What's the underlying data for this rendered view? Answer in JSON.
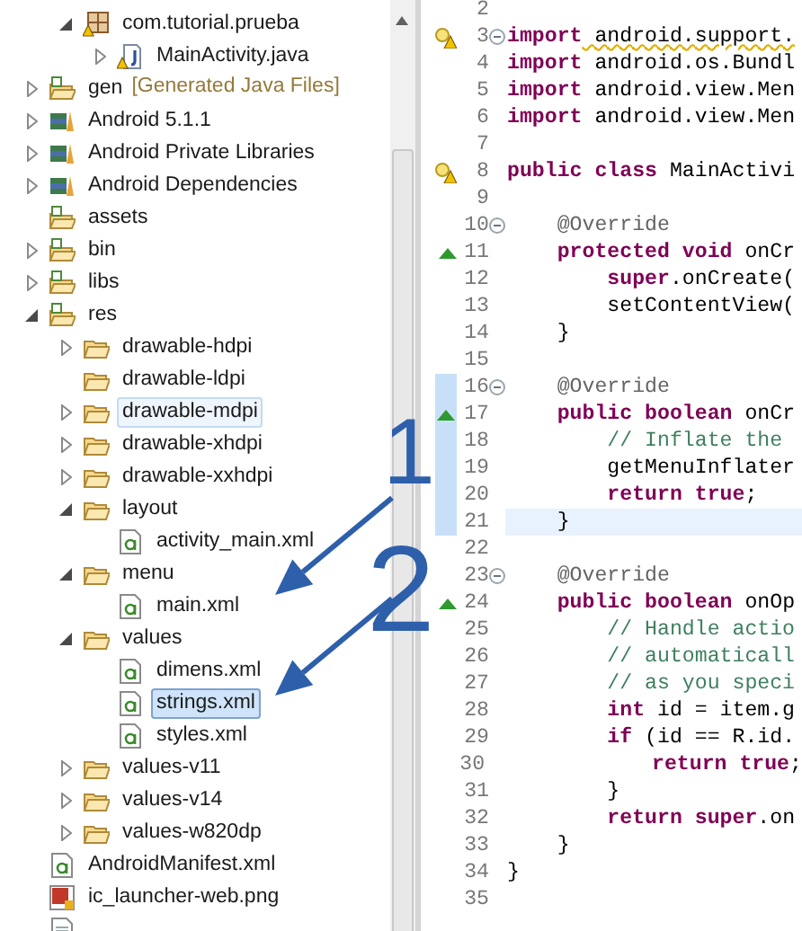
{
  "tree": {
    "scrolled_children": [
      {
        "label": "com.tutorial.prueba",
        "kind": "package",
        "expanded": true,
        "selected": false,
        "hovered": false,
        "children": [
          {
            "label": "MainActivity.java",
            "kind": "java",
            "expanded": false,
            "selected": false,
            "hovered": false
          }
        ]
      }
    ],
    "items": [
      {
        "label": "gen",
        "note": "[Generated Java Files]",
        "kind": "source-folder",
        "expanded": false,
        "selected": false,
        "hovered": false
      },
      {
        "label": "Android 5.1.1",
        "kind": "library",
        "expanded": false,
        "selected": false,
        "hovered": false
      },
      {
        "label": "Android Private Libraries",
        "kind": "library",
        "expanded": false,
        "selected": false,
        "hovered": false
      },
      {
        "label": "Android Dependencies",
        "kind": "library",
        "expanded": false,
        "selected": false,
        "hovered": false
      },
      {
        "label": "assets",
        "kind": "source-folder",
        "selected": false,
        "hovered": false
      },
      {
        "label": "bin",
        "kind": "source-folder",
        "expanded": false,
        "selected": false,
        "hovered": false
      },
      {
        "label": "libs",
        "kind": "source-folder",
        "expanded": false,
        "selected": false,
        "hovered": false
      },
      {
        "label": "res",
        "kind": "source-folder",
        "expanded": true,
        "selected": false,
        "hovered": false,
        "children": [
          {
            "label": "drawable-hdpi",
            "kind": "folder",
            "expanded": false,
            "selected": false,
            "hovered": false
          },
          {
            "label": "drawable-ldpi",
            "kind": "folder",
            "selected": false,
            "hovered": false
          },
          {
            "label": "drawable-mdpi",
            "kind": "folder",
            "expanded": false,
            "selected": false,
            "hovered": true
          },
          {
            "label": "drawable-xhdpi",
            "kind": "folder",
            "expanded": false,
            "selected": false,
            "hovered": false
          },
          {
            "label": "drawable-xxhdpi",
            "kind": "folder",
            "expanded": false,
            "selected": false,
            "hovered": false
          },
          {
            "label": "layout",
            "kind": "folder",
            "expanded": true,
            "selected": false,
            "hovered": false,
            "children": [
              {
                "label": "activity_main.xml",
                "kind": "xml",
                "selected": false,
                "hovered": false
              }
            ]
          },
          {
            "label": "menu",
            "kind": "folder",
            "expanded": true,
            "selected": false,
            "hovered": false,
            "children": [
              {
                "label": "main.xml",
                "kind": "xml",
                "selected": false,
                "hovered": false
              }
            ]
          },
          {
            "label": "values",
            "kind": "folder",
            "expanded": true,
            "selected": false,
            "hovered": false,
            "children": [
              {
                "label": "dimens.xml",
                "kind": "xml",
                "selected": false,
                "hovered": false
              },
              {
                "label": "strings.xml",
                "kind": "xml",
                "selected": true,
                "hovered": false
              },
              {
                "label": "styles.xml",
                "kind": "xml",
                "selected": false,
                "hovered": false
              }
            ]
          },
          {
            "label": "values-v11",
            "kind": "folder",
            "expanded": false,
            "selected": false,
            "hovered": false
          },
          {
            "label": "values-v14",
            "kind": "folder",
            "expanded": false,
            "selected": false,
            "hovered": false
          },
          {
            "label": "values-w820dp",
            "kind": "folder",
            "expanded": false,
            "selected": false,
            "hovered": false
          }
        ]
      },
      {
        "label": "AndroidManifest.xml",
        "kind": "xml",
        "selected": false,
        "hovered": false
      },
      {
        "label": "ic_launcher-web.png",
        "kind": "image",
        "selected": false,
        "hovered": false
      },
      {
        "kind": "text"
      }
    ]
  },
  "editor": {
    "lines": [
      {
        "number": "2"
      },
      {
        "number": "3",
        "warning_marker": true,
        "fold": true,
        "tokens": [
          {
            "kind": "keyword",
            "text": "import"
          },
          {
            "kind": "warning",
            "text": " android.support."
          }
        ]
      },
      {
        "number": "4",
        "tokens": [
          {
            "kind": "keyword",
            "text": "import"
          },
          {
            "kind": "plain",
            "text": " android.os.Bundl"
          }
        ]
      },
      {
        "number": "5",
        "tokens": [
          {
            "kind": "keyword",
            "text": "import"
          },
          {
            "kind": "plain",
            "text": " android.view.Men"
          }
        ]
      },
      {
        "number": "6",
        "tokens": [
          {
            "kind": "keyword",
            "text": "import"
          },
          {
            "kind": "plain",
            "text": " android.view.Men"
          }
        ]
      },
      {
        "number": "7"
      },
      {
        "number": "8",
        "warning_marker": true,
        "tokens": [
          {
            "kind": "keyword",
            "text": "public class"
          },
          {
            "kind": "plain",
            "text": " MainActivi"
          }
        ]
      },
      {
        "number": "9"
      },
      {
        "number": "10",
        "fold": true,
        "tokens": [
          {
            "kind": "annotation",
            "text": "    @Override"
          }
        ]
      },
      {
        "number": "11",
        "override_marker": true,
        "tokens": [
          {
            "kind": "keyword",
            "text": "    protected void"
          },
          {
            "kind": "plain",
            "text": " onCr"
          }
        ]
      },
      {
        "number": "12",
        "tokens": [
          {
            "kind": "keyword",
            "text": "        super"
          },
          {
            "kind": "plain",
            "text": ".onCreate("
          }
        ]
      },
      {
        "number": "13",
        "tokens": [
          {
            "kind": "plain",
            "text": "        setContentView("
          }
        ]
      },
      {
        "number": "14",
        "tokens": [
          {
            "kind": "plain",
            "text": "    }"
          }
        ]
      },
      {
        "number": "15"
      },
      {
        "number": "16",
        "fold": true,
        "changed": true,
        "tokens": [
          {
            "kind": "annotation",
            "text": "    @Override"
          }
        ]
      },
      {
        "number": "17",
        "override_marker": true,
        "changed": true,
        "tokens": [
          {
            "kind": "keyword",
            "text": "    public boolean"
          },
          {
            "kind": "plain",
            "text": " onCr"
          }
        ]
      },
      {
        "number": "18",
        "changed": true,
        "tokens": [
          {
            "kind": "comment",
            "text": "        // Inflate the"
          }
        ]
      },
      {
        "number": "19",
        "changed": true,
        "tokens": [
          {
            "kind": "plain",
            "text": "        getMenuInflater"
          }
        ]
      },
      {
        "number": "20",
        "changed": true,
        "tokens": [
          {
            "kind": "keyword",
            "text": "        return true"
          },
          {
            "kind": "plain",
            "text": ";"
          }
        ]
      },
      {
        "number": "21",
        "changed": true,
        "current": true,
        "tokens": [
          {
            "kind": "plain",
            "text": "    }"
          }
        ]
      },
      {
        "number": "22"
      },
      {
        "number": "23",
        "fold": true,
        "tokens": [
          {
            "kind": "annotation",
            "text": "    @Override"
          }
        ]
      },
      {
        "number": "24",
        "override_marker": true,
        "tokens": [
          {
            "kind": "keyword",
            "text": "    public boolean"
          },
          {
            "kind": "plain",
            "text": " onOp"
          }
        ]
      },
      {
        "number": "25",
        "tokens": [
          {
            "kind": "comment",
            "text": "        // Handle actio"
          }
        ]
      },
      {
        "number": "26",
        "tokens": [
          {
            "kind": "comment",
            "text": "        // automaticall"
          }
        ]
      },
      {
        "number": "27",
        "tokens": [
          {
            "kind": "comment",
            "text": "        // as you speci"
          }
        ]
      },
      {
        "number": "28",
        "tokens": [
          {
            "kind": "keyword",
            "text": "        int"
          },
          {
            "kind": "plain",
            "text": " id = item.g"
          }
        ]
      },
      {
        "number": "29",
        "tokens": [
          {
            "kind": "keyword",
            "text": "        if"
          },
          {
            "kind": "plain",
            "text": " (id == R.id."
          }
        ]
      },
      {
        "number": "30",
        "tokens": [
          {
            "kind": "keyword",
            "text": "            return true"
          },
          {
            "kind": "plain",
            "text": ";"
          }
        ]
      },
      {
        "number": "31",
        "tokens": [
          {
            "kind": "plain",
            "text": "        }"
          }
        ]
      },
      {
        "number": "32",
        "tokens": [
          {
            "kind": "keyword",
            "text": "        return super"
          },
          {
            "kind": "plain",
            "text": ".on"
          }
        ]
      },
      {
        "number": "33",
        "tokens": [
          {
            "kind": "plain",
            "text": "    }"
          }
        ]
      },
      {
        "number": "34",
        "tokens": [
          {
            "kind": "plain",
            "text": "}"
          }
        ]
      },
      {
        "number": "35"
      }
    ]
  },
  "annotations": [
    {
      "label": "1"
    },
    {
      "label": "2"
    }
  ]
}
